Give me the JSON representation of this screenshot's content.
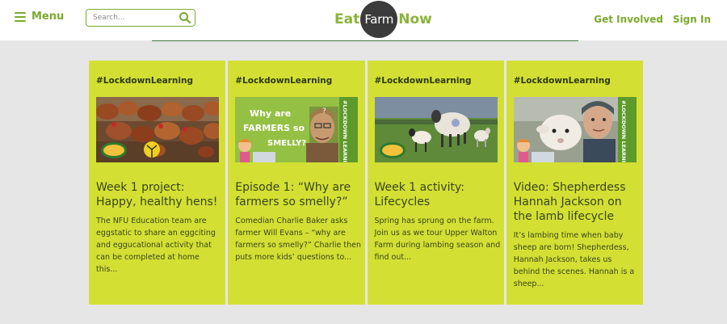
{
  "header": {
    "menu_label": "Menu",
    "search_placeholder": "Search...",
    "logo": {
      "eat": "Eat",
      "farm": "Farm",
      "now": "Now"
    },
    "nav": [
      "Get Involved",
      "Sign In"
    ]
  },
  "colors": {
    "brand_green": "#7aaa2e",
    "card_background": "#d4df34",
    "page_background": "#e6e6e6"
  },
  "cards": [
    {
      "tag": "#LockdownLearning",
      "title": "Week 1 project: Happy, healthy hens!",
      "text": "The NFU Education team are eggstatic to share an eggciting and egguca­tional activity that can be completed at home this..."
    },
    {
      "tag": "#LockdownLearning",
      "title": "Episode 1: “Why are farmers so smelly?”",
      "text": "Comedian Charlie Baker asks farmer Will Evans – “why are farmers so smelly?” Charlie then puts more kids’ questions to...",
      "image_text": {
        "line1": "Why are",
        "line2": "FARMERS so",
        "line3": "SMELLY?",
        "side": "#LOCKDOWN LEARNING"
      }
    },
    {
      "tag": "#LockdownLearning",
      "title": "Week 1 activity: Lifecycles",
      "text": "Spring has sprung on the farm. Join us as we tour Upper Walton Farm during lambing season and find out..."
    },
    {
      "tag": "#LockdownLearning",
      "title": "Video: Shepherdess Hannah Jackson on the lamb lifecycle",
      "text": "It’s lambing time when baby sheep are born! Shepherdess, Hannah Jackson, takes us behind the scenes. Hannah is a sheep...",
      "image_text": {
        "side": "#LOCKDOWN LEARNING"
      }
    }
  ]
}
